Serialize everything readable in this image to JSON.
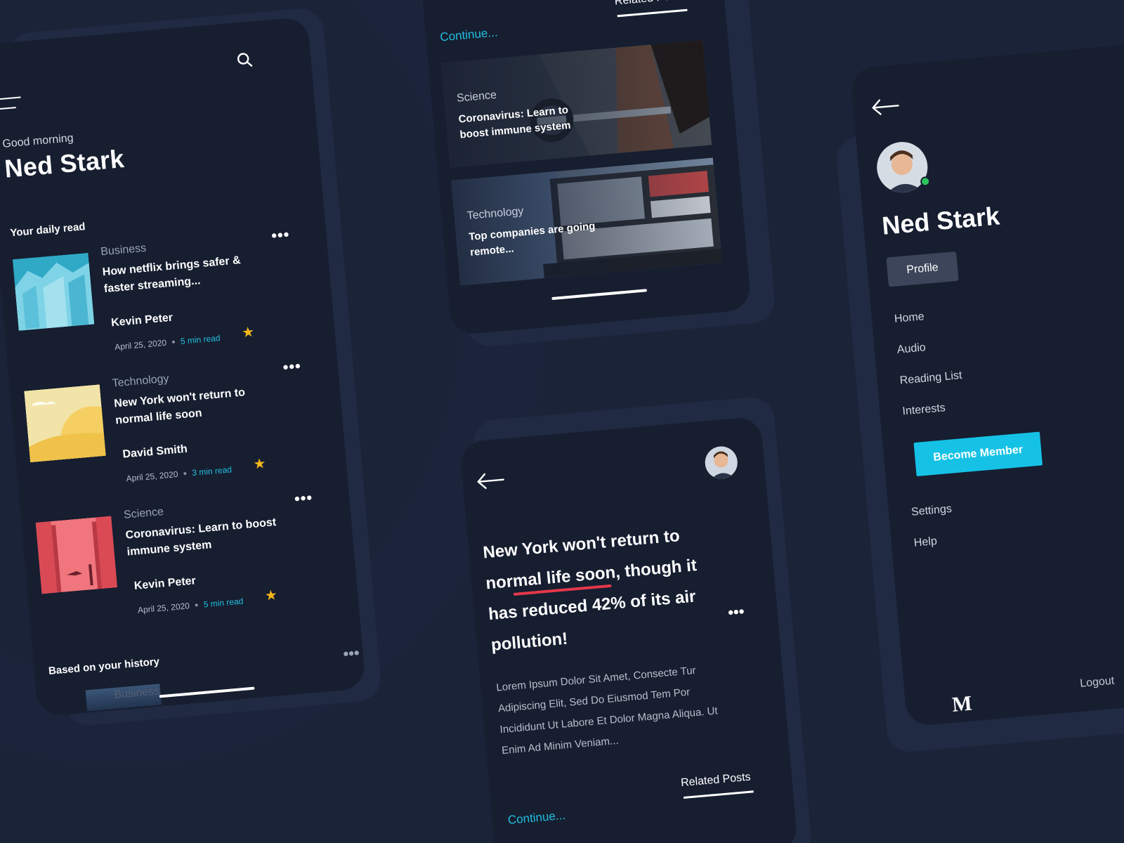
{
  "feed": {
    "greeting": "Good morning",
    "user_name": "Ned Stark",
    "daily_read_title": "Your daily read",
    "articles": [
      {
        "category": "Business",
        "title": "How netflix brings safer & faster streaming...",
        "author": "Kevin Peter",
        "date": "April 25, 2020",
        "read_time": "5 min read",
        "more": "•••"
      },
      {
        "category": "Technology",
        "title": "New York won't return to normal life soon",
        "author": "David Smith",
        "date": "April 25, 2020",
        "read_time": "3 min read",
        "more": "•••"
      },
      {
        "category": "Science",
        "title": "Coronavirus: Learn to boost immune system",
        "author": "Kevin Peter",
        "date": "April 25, 2020",
        "read_time": "5 min read",
        "more": "•••"
      }
    ],
    "history_title": "Based on your history",
    "history_category": "Business",
    "history_more": "•••"
  },
  "related": {
    "continue_label": "Continue...",
    "related_label": "Related Posts",
    "posts": [
      {
        "category": "Science",
        "title": "Coronavirus: Learn to boost immune system"
      },
      {
        "category": "Technology",
        "title": "Top companies are going remote..."
      }
    ]
  },
  "article": {
    "headline": "New York won't return to normal life soon, though it has reduced 42% of its air pollution!",
    "more": "•••",
    "body": "Lorem Ipsum Dolor Sit Amet, Consecte Tur Adipiscing Elit, Sed Do Eiusmod Tem Por Incididunt Ut Labore Et Dolor Magna Aliqua. Ut Enim Ad Minim Veniam...",
    "continue_label": "Continue...",
    "related_label": "Related Posts"
  },
  "menu": {
    "user_name": "Ned Stark",
    "profile_label": "Profile",
    "items": [
      "Home",
      "Audio",
      "Reading List",
      "Interests"
    ],
    "member_label": "Become Member",
    "bottom_items": [
      "Settings",
      "Help"
    ],
    "logo": "M",
    "logout_label": "Logout"
  },
  "colors": {
    "background": "#1a2337",
    "card": "#161e30",
    "accent": "#15c2e6",
    "star": "#f5b81b",
    "highlight": "#e5384a",
    "online": "#2bc45a"
  },
  "icons": [
    "menu-icon",
    "search-icon",
    "star-icon",
    "more-icon",
    "back-arrow-icon"
  ]
}
